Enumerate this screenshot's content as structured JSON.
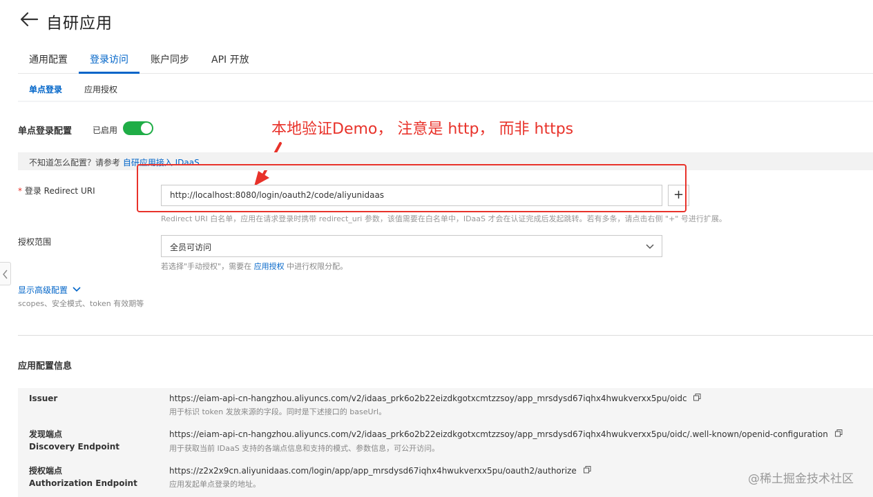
{
  "header": {
    "title": "自研应用"
  },
  "tabs": [
    {
      "label": "通用配置"
    },
    {
      "label": "登录访问",
      "active": true
    },
    {
      "label": "账户同步"
    },
    {
      "label": "API 开放"
    }
  ],
  "subtabs": [
    {
      "label": "单点登录",
      "active": true
    },
    {
      "label": "应用授权"
    }
  ],
  "sso": {
    "title": "单点登录配置",
    "status_label": "已启用",
    "enabled": true,
    "hint_text": "不知道怎么配置？请参考 ",
    "hint_link": "自研应用接入 IDaaS"
  },
  "annotation": {
    "text": "本地验证Demo， 注意是 http， 而非 https",
    "color": "#e8322a"
  },
  "redirect": {
    "required_mark": "*",
    "label": "登录 Redirect URI",
    "value": "http://localhost:8080/login/oauth2/code/aliyunidaas",
    "add_label": "+",
    "help": "Redirect URI 白名单，应用在请求登录时携带 redirect_uri 参数，该值需要在白名单中，IDaaS 才会在认证完成后发起跳转。若有多条，请点击右侧 \"+\" 号进行扩展。"
  },
  "scope": {
    "label": "授权范围",
    "selected": "全员可访问",
    "help_prefix": "若选择\"手动授权\"，需要在 ",
    "help_link": "应用授权",
    "help_suffix": " 中进行权限分配。"
  },
  "advanced": {
    "link": "显示高级配置",
    "desc": "scopes、安全模式、token 有效期等"
  },
  "app_info": {
    "title": "应用配置信息",
    "rows": [
      {
        "label": "Issuer",
        "label2": "",
        "url": "https://eiam-api-cn-hangzhou.aliyuncs.com/v2/idaas_prk6o2b22eizdkgotxcmtzzsoy/app_mrsdysd67iqhx4hwukverxx5pu/oidc",
        "desc": "用于标识 token 发放来源的字段。同时是下述接口的 baseUrl。"
      },
      {
        "label": "发现端点",
        "label2": "Discovery Endpoint",
        "url": "https://eiam-api-cn-hangzhou.aliyuncs.com/v2/idaas_prk6o2b22eizdkgotxcmtzzsoy/app_mrsdysd67iqhx4hwukverxx5pu/oidc/.well-known/openid-configuration",
        "desc": "用于获取当前 IDaaS 支持的各端点信息和支持的模式、参数信息，可公开访问。"
      },
      {
        "label": "授权端点",
        "label2": "Authorization Endpoint",
        "url": "https://z2x2x9cn.aliyunidaas.com/login/app/app_mrsdysd67iqhx4hwukverxx5pu/oauth2/authorize",
        "desc": "应用发起单点登录的地址。"
      }
    ]
  },
  "watermark": {
    "text": "@稀土掘金技术社区"
  },
  "colors": {
    "accent": "#0064c8",
    "toggle_on": "#1fad46",
    "annotation": "#e8322a"
  },
  "icons": [
    "back-arrow-icon",
    "arrow-annotation-icon",
    "chevron-down-icon",
    "copy-icon",
    "chevron-left-icon"
  ]
}
